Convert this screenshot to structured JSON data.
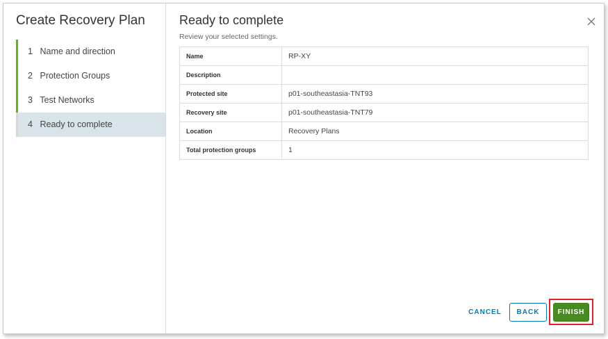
{
  "wizard": {
    "title": "Create Recovery Plan",
    "steps": [
      {
        "number": "1",
        "label": "Name and direction",
        "state": "done"
      },
      {
        "number": "2",
        "label": "Protection Groups",
        "state": "done"
      },
      {
        "number": "3",
        "label": "Test Networks",
        "state": "done"
      },
      {
        "number": "4",
        "label": "Ready to complete",
        "state": "current"
      }
    ]
  },
  "page": {
    "title": "Ready to complete",
    "subtitle": "Review your selected settings."
  },
  "summary": [
    {
      "key": "Name",
      "value": "RP-XY"
    },
    {
      "key": "Description",
      "value": ""
    },
    {
      "key": "Protected site",
      "value": "p01-southeastasia-TNT93"
    },
    {
      "key": "Recovery site",
      "value": "p01-southeastasia-TNT79"
    },
    {
      "key": "Location",
      "value": "Recovery Plans"
    },
    {
      "key": "Total protection groups",
      "value": "1"
    }
  ],
  "buttons": {
    "cancel": "CANCEL",
    "back": "BACK",
    "finish": "FINISH"
  },
  "icons": {
    "close": "close-icon"
  },
  "colors": {
    "step_done": "#60b515",
    "step_current_bg": "#d9e4ea",
    "primary_blue": "#0079b8",
    "finish_green": "#4a8a22",
    "highlight_red": "#e0202a"
  }
}
